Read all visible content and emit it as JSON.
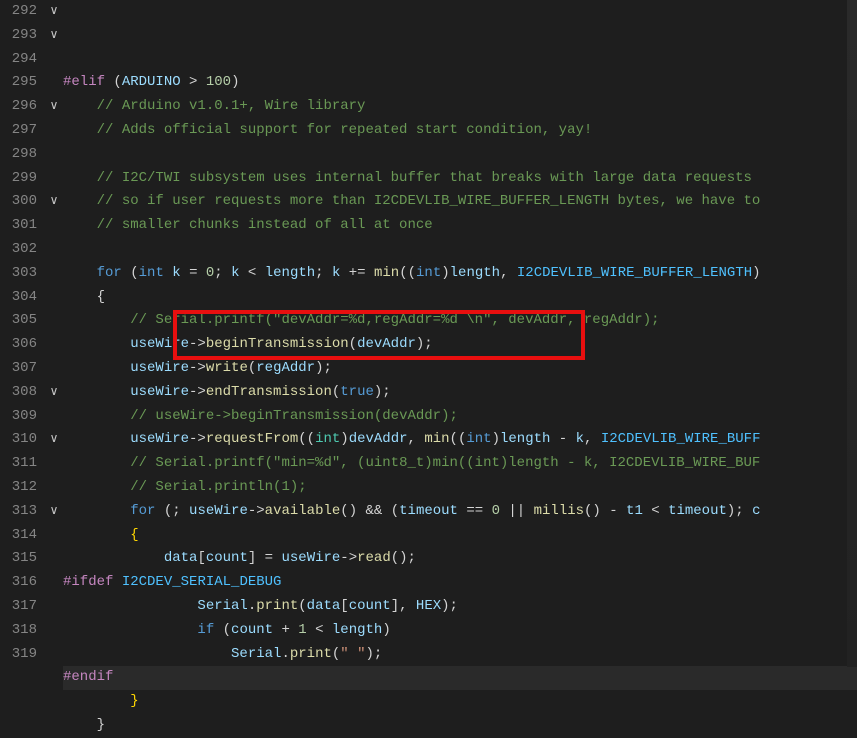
{
  "gutter": {
    "start": 292,
    "end": 319,
    "folds": {
      "292": "∨",
      "293": "∨",
      "296": "∨",
      "300": "∨",
      "308": "∨",
      "310": "∨",
      "313": "∨"
    }
  },
  "highlight_line": 317,
  "lines": {
    "292": {
      "tokens": [
        [
          "pp",
          "#elif"
        ],
        [
          "p",
          " "
        ],
        [
          "p",
          "("
        ],
        [
          "id",
          "ARDUINO"
        ],
        [
          "p",
          " "
        ],
        [
          "op",
          ">"
        ],
        [
          "p",
          " "
        ],
        [
          "num",
          "100"
        ],
        [
          "p",
          ")"
        ]
      ]
    },
    "293": {
      "indent": 4,
      "tokens": [
        [
          "cmt",
          "// Arduino v1.0.1+, Wire library"
        ]
      ]
    },
    "294": {
      "indent": 4,
      "tokens": [
        [
          "cmt",
          "// Adds official support for repeated start condition, yay!"
        ]
      ]
    },
    "295": {
      "tokens": []
    },
    "296": {
      "indent": 4,
      "tokens": [
        [
          "cmt",
          "// I2C/TWI subsystem uses internal buffer that breaks with large data requests"
        ]
      ]
    },
    "297": {
      "indent": 4,
      "tokens": [
        [
          "cmt",
          "// so if user requests more than I2CDEVLIB_WIRE_BUFFER_LENGTH bytes, we have to"
        ]
      ]
    },
    "298": {
      "indent": 4,
      "tokens": [
        [
          "cmt",
          "// smaller chunks instead of all at once"
        ]
      ]
    },
    "299": {
      "tokens": []
    },
    "300": {
      "indent": 4,
      "tokens": [
        [
          "kw",
          "for"
        ],
        [
          "p",
          " ("
        ],
        [
          "type",
          "int"
        ],
        [
          "p",
          " "
        ],
        [
          "id",
          "k"
        ],
        [
          "p",
          " "
        ],
        [
          "op",
          "="
        ],
        [
          "p",
          " "
        ],
        [
          "num",
          "0"
        ],
        [
          "p",
          "; "
        ],
        [
          "id",
          "k"
        ],
        [
          "p",
          " "
        ],
        [
          "op",
          "<"
        ],
        [
          "p",
          " "
        ],
        [
          "id",
          "length"
        ],
        [
          "p",
          "; "
        ],
        [
          "id",
          "k"
        ],
        [
          "p",
          " "
        ],
        [
          "op",
          "+="
        ],
        [
          "p",
          " "
        ],
        [
          "fn",
          "min"
        ],
        [
          "p",
          "(("
        ],
        [
          "type",
          "int"
        ],
        [
          "p",
          ")"
        ],
        [
          "id",
          "length"
        ],
        [
          "p",
          ", "
        ],
        [
          "const",
          "I2CDEVLIB_WIRE_BUFFER_LENGTH"
        ],
        [
          "p",
          ")"
        ]
      ]
    },
    "301": {
      "indent": 4,
      "tokens": [
        [
          "p",
          "{"
        ]
      ]
    },
    "302": {
      "indent": 8,
      "tokens": [
        [
          "cmt",
          "// Serial.printf(\"devAddr=%d,regAddr=%d \\n\", devAddr, regAddr);"
        ]
      ]
    },
    "303": {
      "indent": 8,
      "tokens": [
        [
          "id",
          "useWire"
        ],
        [
          "op",
          "->"
        ],
        [
          "fn",
          "beginTransmission"
        ],
        [
          "p",
          "("
        ],
        [
          "id",
          "devAddr"
        ],
        [
          "p",
          ");"
        ]
      ]
    },
    "304": {
      "indent": 8,
      "tokens": [
        [
          "id",
          "useWire"
        ],
        [
          "op",
          "->"
        ],
        [
          "fn",
          "write"
        ],
        [
          "p",
          "("
        ],
        [
          "id",
          "regAddr"
        ],
        [
          "p",
          ");"
        ]
      ]
    },
    "305": {
      "indent": 8,
      "tokens": [
        [
          "id",
          "useWire"
        ],
        [
          "op",
          "->"
        ],
        [
          "fn",
          "endTransmission"
        ],
        [
          "p",
          "("
        ],
        [
          "kw",
          "true"
        ],
        [
          "p",
          ");"
        ]
      ]
    },
    "306": {
      "indent": 8,
      "tokens": [
        [
          "cmt",
          "// useWire->beginTransmission(devAddr);"
        ]
      ]
    },
    "307": {
      "indent": 8,
      "tokens": [
        [
          "id",
          "useWire"
        ],
        [
          "op",
          "->"
        ],
        [
          "fn",
          "requestFrom"
        ],
        [
          "p",
          "(("
        ],
        [
          "typec",
          "int"
        ],
        [
          "p",
          ")"
        ],
        [
          "id",
          "devAddr"
        ],
        [
          "p",
          ", "
        ],
        [
          "fn",
          "min"
        ],
        [
          "p",
          "(("
        ],
        [
          "type",
          "int"
        ],
        [
          "p",
          ")"
        ],
        [
          "id",
          "length"
        ],
        [
          "p",
          " - "
        ],
        [
          "id",
          "k"
        ],
        [
          "p",
          ", "
        ],
        [
          "const",
          "I2CDEVLIB_WIRE_BUFF"
        ]
      ]
    },
    "308": {
      "indent": 8,
      "tokens": [
        [
          "cmt",
          "// Serial.printf(\"min=%d\", (uint8_t)min((int)length - k, I2CDEVLIB_WIRE_BUF"
        ]
      ]
    },
    "309": {
      "indent": 8,
      "tokens": [
        [
          "cmt",
          "// Serial.println(1);"
        ]
      ]
    },
    "310": {
      "indent": 8,
      "tokens": [
        [
          "kw",
          "for"
        ],
        [
          "p",
          " (; "
        ],
        [
          "id",
          "useWire"
        ],
        [
          "op",
          "->"
        ],
        [
          "fn",
          "available"
        ],
        [
          "p",
          "() "
        ],
        [
          "op",
          "&&"
        ],
        [
          "p",
          " ("
        ],
        [
          "id",
          "timeout"
        ],
        [
          "p",
          " "
        ],
        [
          "op",
          "=="
        ],
        [
          "p",
          " "
        ],
        [
          "num",
          "0"
        ],
        [
          "p",
          " "
        ],
        [
          "op",
          "||"
        ],
        [
          "p",
          " "
        ],
        [
          "fn",
          "millis"
        ],
        [
          "p",
          "() - "
        ],
        [
          "id",
          "t1"
        ],
        [
          "p",
          " "
        ],
        [
          "op",
          "<"
        ],
        [
          "p",
          " "
        ],
        [
          "id",
          "timeout"
        ],
        [
          "p",
          "); "
        ],
        [
          "id",
          "c"
        ]
      ]
    },
    "311": {
      "indent": 8,
      "tokens": [
        [
          "mb",
          "{"
        ]
      ]
    },
    "312": {
      "indent": 12,
      "tokens": [
        [
          "id",
          "data"
        ],
        [
          "p",
          "["
        ],
        [
          "id",
          "count"
        ],
        [
          "p",
          "] "
        ],
        [
          "op",
          "="
        ],
        [
          "p",
          " "
        ],
        [
          "id",
          "useWire"
        ],
        [
          "op",
          "->"
        ],
        [
          "fn",
          "read"
        ],
        [
          "p",
          "();"
        ]
      ]
    },
    "313": {
      "tokens": [
        [
          "pp",
          "#ifdef"
        ],
        [
          "p",
          " "
        ],
        [
          "const",
          "I2CDEV_SERIAL_DEBUG"
        ]
      ]
    },
    "314": {
      "indent": 16,
      "tokens": [
        [
          "id",
          "Serial"
        ],
        [
          "p",
          "."
        ],
        [
          "fn",
          "print"
        ],
        [
          "p",
          "("
        ],
        [
          "id",
          "data"
        ],
        [
          "p",
          "["
        ],
        [
          "id",
          "count"
        ],
        [
          "p",
          "], "
        ],
        [
          "id",
          "HEX"
        ],
        [
          "p",
          ");"
        ]
      ]
    },
    "315": {
      "indent": 16,
      "tokens": [
        [
          "kw",
          "if"
        ],
        [
          "p",
          " ("
        ],
        [
          "id",
          "count"
        ],
        [
          "p",
          " + "
        ],
        [
          "num",
          "1"
        ],
        [
          "p",
          " "
        ],
        [
          "op",
          "<"
        ],
        [
          "p",
          " "
        ],
        [
          "id",
          "length"
        ],
        [
          "p",
          ")"
        ]
      ]
    },
    "316": {
      "indent": 20,
      "tokens": [
        [
          "id",
          "Serial"
        ],
        [
          "p",
          "."
        ],
        [
          "fn",
          "print"
        ],
        [
          "p",
          "("
        ],
        [
          "str",
          "\" \""
        ],
        [
          "p",
          ");"
        ]
      ]
    },
    "317": {
      "tokens": [
        [
          "pp",
          "#endif"
        ]
      ]
    },
    "318": {
      "indent": 8,
      "tokens": [
        [
          "mb",
          "}"
        ]
      ]
    },
    "319": {
      "indent": 4,
      "tokens": [
        [
          "p",
          "}"
        ]
      ]
    }
  },
  "redbox": {
    "covers_lines": [
      305,
      306
    ]
  }
}
